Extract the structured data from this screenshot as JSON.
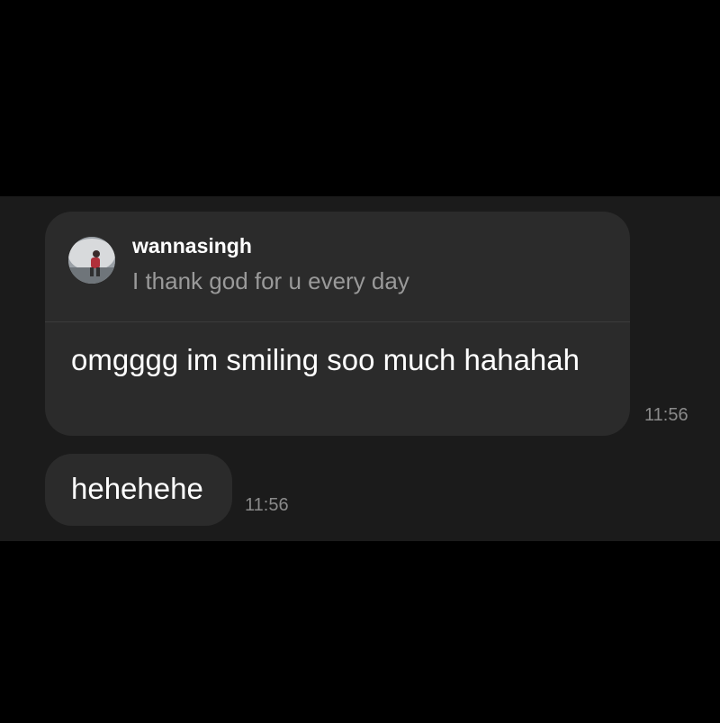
{
  "reply": {
    "username": "wannasingh",
    "quoted_text": "I thank god for u every day"
  },
  "messages": [
    {
      "text": "omgggg im smiling soo much hahahah",
      "time": "11:56"
    },
    {
      "text": "hehehehe",
      "time": "11:56"
    }
  ],
  "colors": {
    "background": "#000000",
    "chat_background": "#1b1b1b",
    "bubble": "#2b2b2b",
    "text": "#ffffff",
    "secondary_text": "#9a9a9a"
  },
  "icons": {
    "avatar": "profile-photo"
  }
}
